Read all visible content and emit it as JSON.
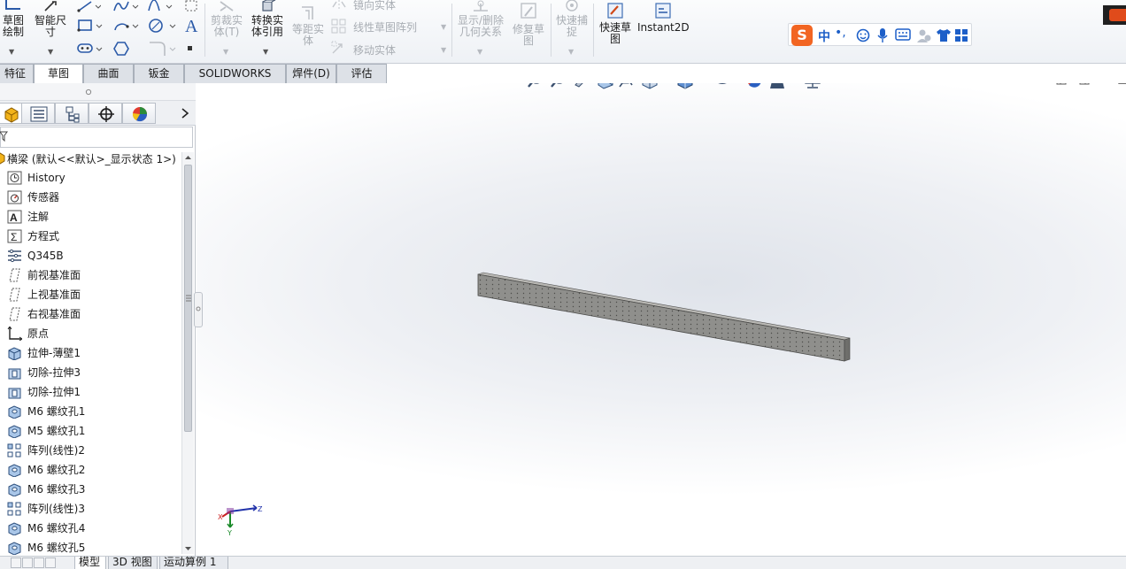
{
  "ribbon": {
    "sketch_label": "草图绘制",
    "smart_dim_label": "智能尺寸",
    "trim_label": "剪裁实体(T)",
    "convert_label": "转换实体引用",
    "offset_label": "等距实体",
    "mirror_label": "镜向实体",
    "linear_pattern_label": "线性草图阵列",
    "move_label": "移动实体",
    "relations_label": "显示/删除几何关系",
    "repair_label": "修复草图",
    "snap_label": "快速捕捉",
    "rapid_sketch_label": "快速草图",
    "instant2d_label": "Instant2D"
  },
  "tabs": [
    {
      "label": "特征"
    },
    {
      "label": "草图"
    },
    {
      "label": "曲面"
    },
    {
      "label": "钣金"
    },
    {
      "label": "SOLIDWORKS MBD"
    },
    {
      "label": "焊件(D)"
    },
    {
      "label": "评估"
    }
  ],
  "ime": {
    "logo": "S",
    "lang": "中",
    "punct": "•,"
  },
  "tree": {
    "root": "横梁 (默认<<默认>_显示状态 1>)",
    "items": [
      {
        "label": "History",
        "icon": "history-icon"
      },
      {
        "label": "传感器",
        "icon": "sensor-icon"
      },
      {
        "label": "注解",
        "icon": "annotation-icon"
      },
      {
        "label": "方程式",
        "icon": "equation-icon"
      },
      {
        "label": "Q345B",
        "icon": "material-icon"
      },
      {
        "label": "前视基准面",
        "icon": "plane-icon"
      },
      {
        "label": "上视基准面",
        "icon": "plane-icon"
      },
      {
        "label": "右视基准面",
        "icon": "plane-icon"
      },
      {
        "label": "原点",
        "icon": "origin-icon"
      },
      {
        "label": "拉伸-薄壁1",
        "icon": "extrude-icon"
      },
      {
        "label": "切除-拉伸3",
        "icon": "cut-extrude-icon"
      },
      {
        "label": "切除-拉伸1",
        "icon": "cut-extrude-icon"
      },
      {
        "label": "M6 螺纹孔1",
        "icon": "hole-icon"
      },
      {
        "label": "M5 螺纹孔1",
        "icon": "hole-icon"
      },
      {
        "label": "阵列(线性)2",
        "icon": "linear-pattern-icon"
      },
      {
        "label": "M6 螺纹孔2",
        "icon": "hole-icon"
      },
      {
        "label": "M6 螺纹孔3",
        "icon": "hole-icon"
      },
      {
        "label": "阵列(线性)3",
        "icon": "linear-pattern-icon"
      },
      {
        "label": "M6 螺纹孔4",
        "icon": "hole-icon"
      },
      {
        "label": "M6 螺纹孔5",
        "icon": "hole-icon"
      }
    ]
  },
  "triad": {
    "x": "X",
    "y": "Y",
    "z": "Z"
  },
  "bottom_tabs": [
    {
      "label": "模型"
    },
    {
      "label": "3D 视图"
    },
    {
      "label": "运动算例 1"
    }
  ],
  "colors": {
    "accent": "#1d5fc8",
    "beam": "#8f8f8c",
    "ime_brand": "#f26522"
  }
}
